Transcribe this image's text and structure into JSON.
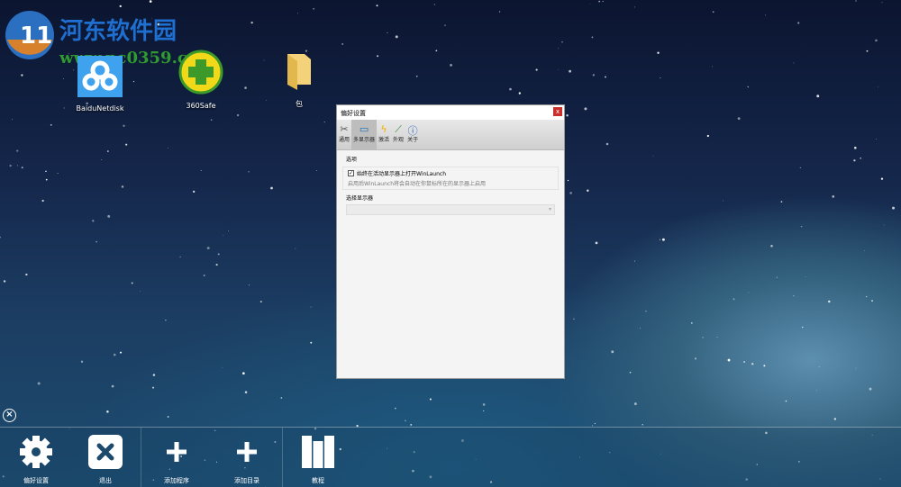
{
  "watermark": {
    "title": "河东软件园",
    "url": "www.pc0359.cn"
  },
  "desktop": [
    {
      "label": "BaiduNetdisk"
    },
    {
      "label": "360Safe"
    },
    {
      "label": "包"
    }
  ],
  "dialog": {
    "title": "偏好设置",
    "close": "x",
    "toolbar": [
      {
        "label": "通用",
        "icon": "tools-icon"
      },
      {
        "label": "多显示器",
        "icon": "monitor-icon"
      },
      {
        "label": "激活",
        "icon": "lightning-icon"
      },
      {
        "label": "外观",
        "icon": "brush-icon"
      },
      {
        "label": "关于",
        "icon": "info-icon"
      }
    ],
    "options_heading": "选项",
    "checkbox_label": "始终在活动显示器上打开WinLaunch",
    "checkbox_checked": true,
    "checkbox_desc": "启用后WinLaunch将会自动在你鼠标所在的显示器上启用",
    "monitor_heading": "选择显示器",
    "monitor_value": ""
  },
  "bottombar": [
    {
      "label": "偏好设置"
    },
    {
      "label": "退出"
    },
    {
      "label": "添加程序"
    },
    {
      "label": "添加目录"
    },
    {
      "label": "教程"
    }
  ]
}
